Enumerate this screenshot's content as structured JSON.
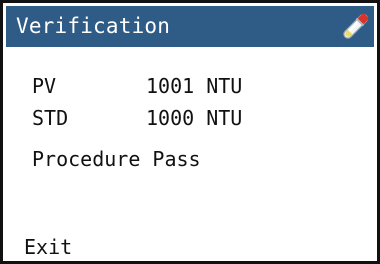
{
  "header": {
    "title": "Verification",
    "icon": "test-tube-icon",
    "background_color": "#2e5c86"
  },
  "measurements": {
    "pv": {
      "label": "PV",
      "value": "1001 NTU"
    },
    "std": {
      "label": "STD",
      "value": "1000 NTU"
    }
  },
  "status": {
    "message": "Procedure Pass"
  },
  "footer": {
    "exit_label": "Exit"
  }
}
